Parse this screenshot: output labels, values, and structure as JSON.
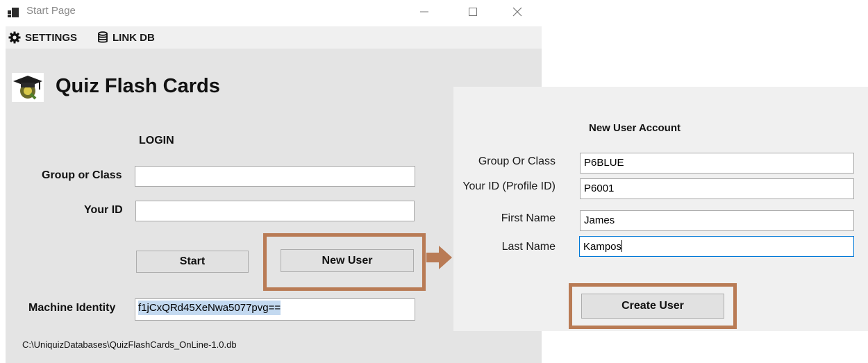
{
  "window": {
    "title": "Start Page",
    "controls": {
      "minimize": "—",
      "maximize": "☐",
      "close": "✕"
    }
  },
  "menu": {
    "settings_label": "SETTINGS",
    "linkdb_label": "LINK DB",
    "settings_icon": "gear-icon",
    "linkdb_icon": "database-icon"
  },
  "app": {
    "title": "Quiz Flash Cards",
    "logo_icon": "graduation-cap-icon"
  },
  "login": {
    "heading": "LOGIN",
    "group_label": "Group or Class",
    "group_value": "",
    "id_label": "Your ID",
    "id_value": "",
    "start_label": "Start",
    "new_user_label": "New User",
    "machine_label": "Machine Identity",
    "machine_value": "f1jCxQRd45XeNwa5077pvg==",
    "db_path": "C:\\UniquizDatabases\\QuizFlashCards_OnLine-1.0.db"
  },
  "new_user": {
    "heading": "New User Account",
    "group_label": "Group Or Class",
    "group_value": "P6BLUE",
    "profile_label": "Your ID (Profile ID)",
    "profile_value": "P6001",
    "first_label": "First Name",
    "first_value": "James",
    "last_label": "Last Name",
    "last_value": "Kampos",
    "create_label": "Create User"
  },
  "colors": {
    "highlight": "#b97b55",
    "selection": "#c3d9f0",
    "focus_border": "#0078d7"
  }
}
